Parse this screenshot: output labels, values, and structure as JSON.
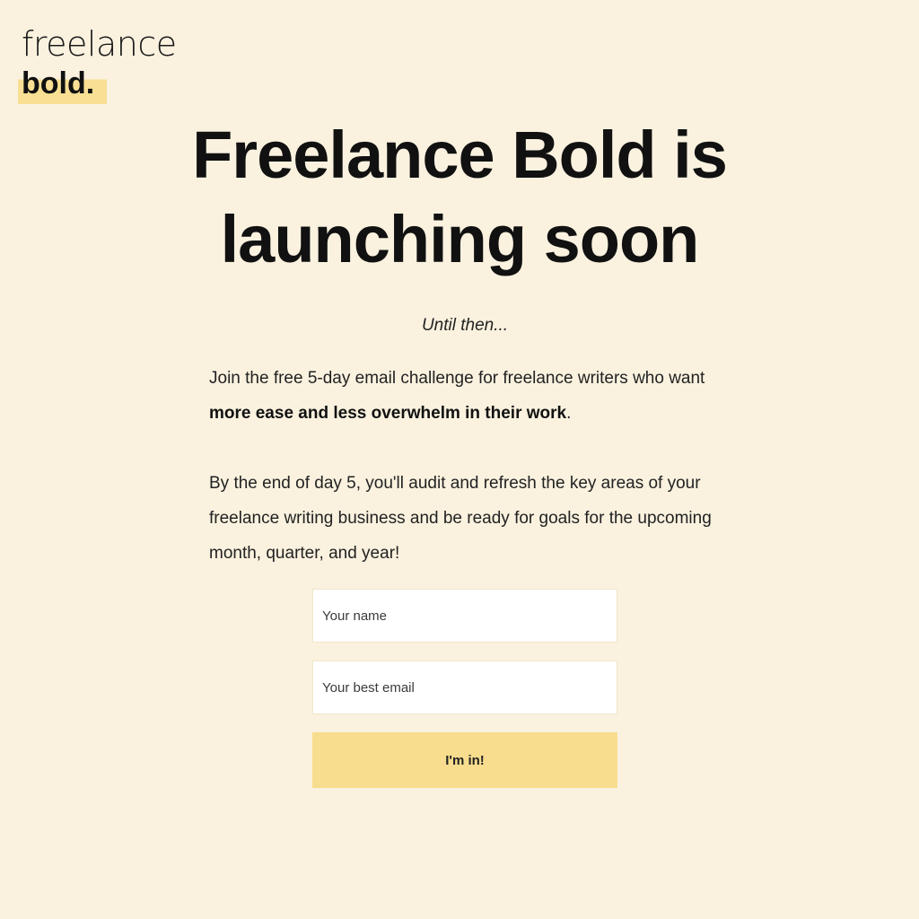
{
  "logo": {
    "line1": "freelance",
    "line2": "bold."
  },
  "headline": {
    "line1": "Freelance Bold is",
    "line2": "launching soon"
  },
  "subtitle": "Until then...",
  "paragraph1": {
    "text": "Join the free 5-day email challenge for freelance writers who want ",
    "bold": "more ease and less overwhelm in their work",
    "end": "."
  },
  "paragraph2": "By the end of day 5, you'll audit and refresh the key areas of your freelance writing business and be ready for goals for the upcoming month, quarter, and year!",
  "form": {
    "name_placeholder": "Your name",
    "name_value": "",
    "email_placeholder": "Your best email",
    "email_value": "",
    "submit_label": "I'm in!"
  },
  "colors": {
    "background": "#faf2df",
    "accent": "#f8dd8e",
    "text": "#111111"
  }
}
